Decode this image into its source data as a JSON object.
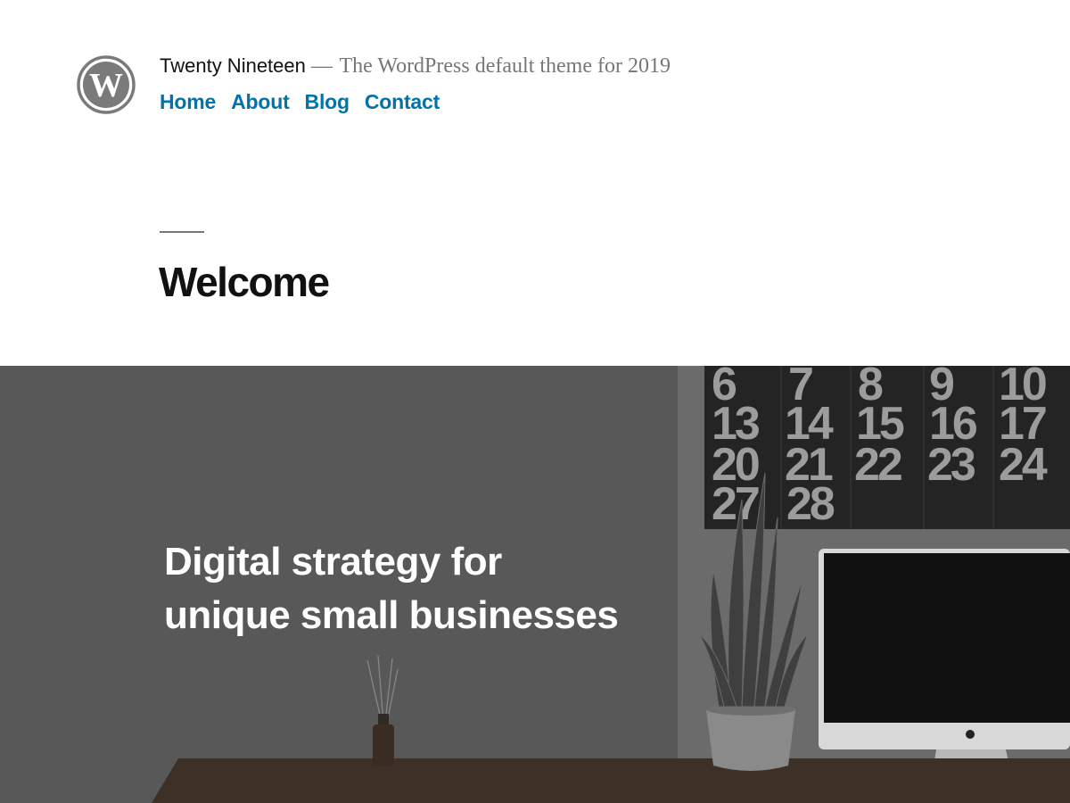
{
  "header": {
    "site_title": "Twenty Nineteen",
    "site_description": "The WordPress default theme for 2019",
    "logo_icon": "wordpress-logo-icon",
    "nav": [
      {
        "label": "Home"
      },
      {
        "label": "About"
      },
      {
        "label": "Blog"
      },
      {
        "label": "Contact"
      }
    ]
  },
  "entry": {
    "title": "Welcome"
  },
  "cover": {
    "heading_line1": "Digital strategy for",
    "heading_line2": "unique small businesses",
    "calendar_numbers": [
      [
        "6",
        "7",
        "8",
        "9",
        "10"
      ],
      [
        "13",
        "14",
        "15",
        "16",
        "17"
      ],
      [
        "20",
        "21",
        "22",
        "23",
        "24"
      ],
      [
        "27",
        "28"
      ]
    ]
  },
  "colors": {
    "link": "#0073aa",
    "title": "#111111",
    "description": "#767676",
    "cover_overlay": "#575757"
  }
}
